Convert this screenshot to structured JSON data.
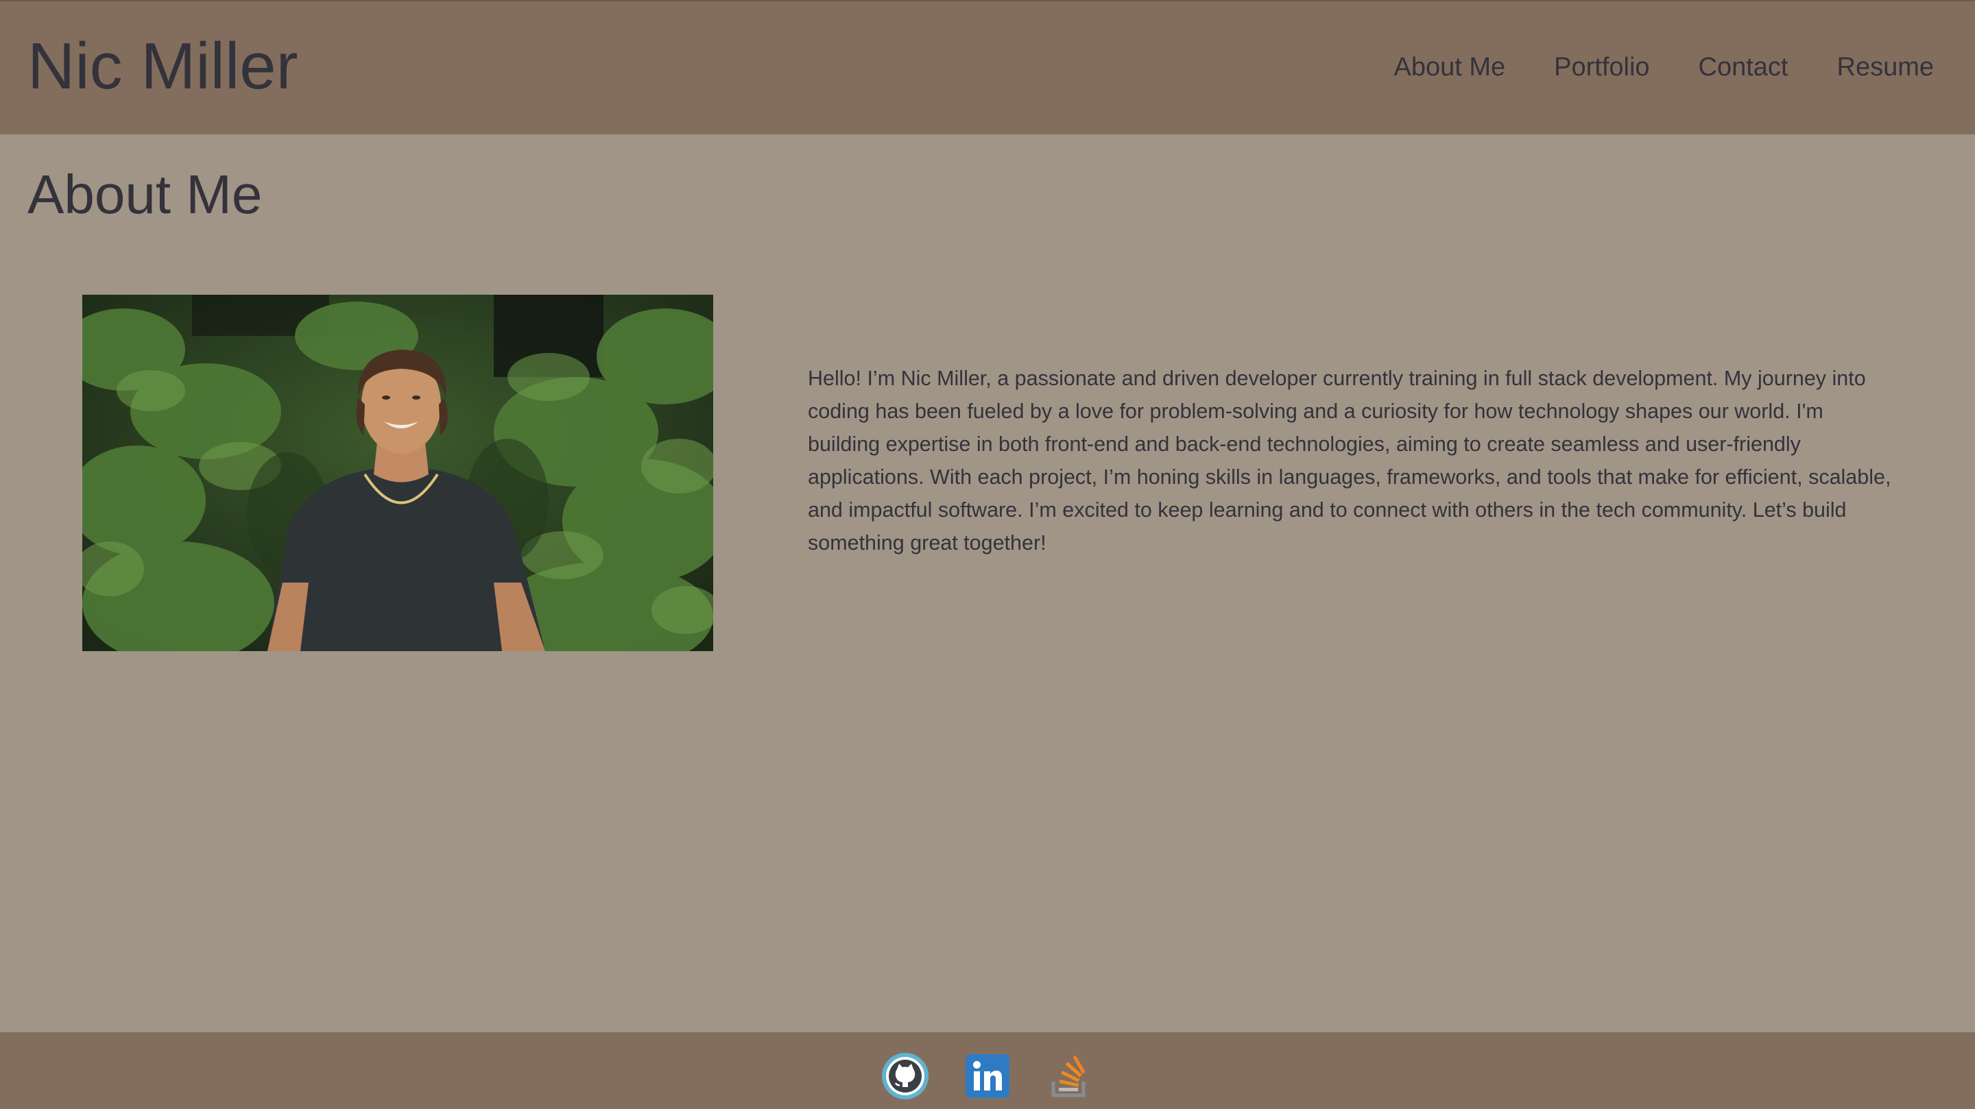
{
  "header": {
    "site_title": "Nic Miller",
    "nav": [
      {
        "label": "About Me"
      },
      {
        "label": "Portfolio"
      },
      {
        "label": "Contact"
      },
      {
        "label": "Resume"
      }
    ]
  },
  "main": {
    "section_title": "About Me",
    "photo": {
      "description_icon": "portrait-photo"
    },
    "bio": "Hello! I’m Nic Miller, a passionate and driven developer currently training in full stack development. My journey into coding has been fueled by a love for problem-solving and a curiosity for how technology shapes our world. I'm building expertise in both front-end and back-end technologies, aiming to create seamless and user-friendly applications. With each project, I’m honing skills in languages, frameworks, and tools that make for efficient, scalable, and impactful software. I’m excited to keep learning and to connect with others in the tech community. Let’s build something great together!"
  },
  "footer": {
    "social_links": [
      {
        "icon": "github-icon"
      },
      {
        "icon": "linkedin-icon"
      },
      {
        "icon": "stackoverflow-icon"
      }
    ]
  },
  "colors": {
    "header_bg": "#836e5e",
    "page_bg": "#a09587",
    "text": "#34323b",
    "footer_bg": "#836e5e"
  }
}
